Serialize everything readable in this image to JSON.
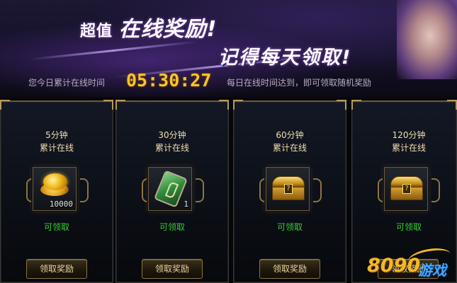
{
  "banner": {
    "title_small": "超值",
    "title_strong": "在线奖励!",
    "subtitle": "记得每天领取!",
    "online_time_label": "您今日累计在线时间",
    "online_time_value": "05:30:27",
    "hint": "每日在线时间达到，即可领取随机奖励"
  },
  "cards": [
    {
      "duration": "5分钟",
      "caption": "累计在线",
      "quantity": "10000",
      "status": "可领取",
      "button": "领取奖励",
      "item_icon": "gold-coins-icon"
    },
    {
      "duration": "30分钟",
      "caption": "累计在线",
      "quantity": "1",
      "status": "可领取",
      "button": "领取奖励",
      "item_icon": "green-card-icon"
    },
    {
      "duration": "60分钟",
      "caption": "累计在线",
      "quantity": "",
      "status": "可领取",
      "button": "领取奖励",
      "item_icon": "treasure-chest-icon"
    },
    {
      "duration": "120分钟",
      "caption": "累计在线",
      "quantity": "",
      "status": "可领取",
      "button": "领取奖励",
      "item_icon": "treasure-chest-icon"
    }
  ],
  "watermark": {
    "number": "8090",
    "text": "游戏"
  },
  "colors": {
    "time": "#ffc427",
    "status": "#38c934",
    "accent_gold": "#b89a5d"
  }
}
